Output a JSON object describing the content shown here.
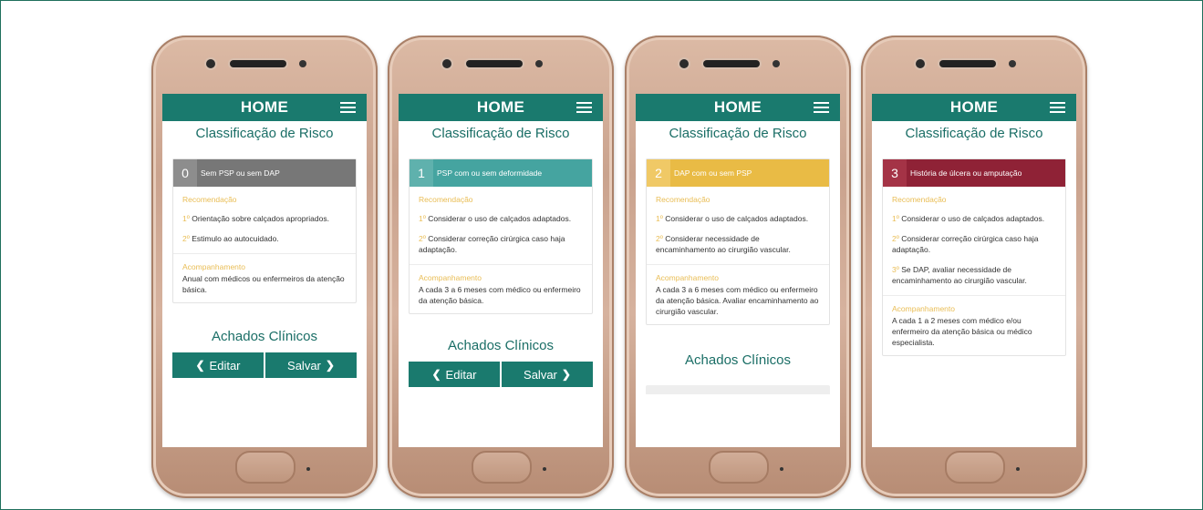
{
  "phones": [
    {
      "home": "HOME",
      "title": "Classificação de Risco",
      "risk": {
        "number": "0",
        "label": "Sem PSP ou sem DAP",
        "num_color": "#8d8d8d",
        "label_color": "#777777"
      },
      "recommendation_title": "Recomendação",
      "recommendations": [
        {
          "ord": "1º",
          "text": " Orientação sobre calçados apropriados."
        },
        {
          "ord": "2º",
          "text": " Estimulo ao autocuidado."
        }
      ],
      "follow_title": "Acompanhamento",
      "follow_text": "Anual com médicos ou enfermeiros da atenção básica.",
      "findings": "Achados Clínicos",
      "edit": "Editar",
      "save": "Salvar"
    },
    {
      "home": "HOME",
      "title": "Classificação de Risco",
      "risk": {
        "number": "1",
        "label": "PSP com ou sem deformidade",
        "num_color": "#5fb1ad",
        "label_color": "#45a4a0"
      },
      "recommendation_title": "Recomendação",
      "recommendations": [
        {
          "ord": "1º",
          "text": " Considerar o uso de calçados adaptados."
        },
        {
          "ord": "2º",
          "text": " Considerar correção cirúrgica caso haja adaptação."
        }
      ],
      "follow_title": "Acompanhamento",
      "follow_text": "A cada 3 a 6 meses com médico ou enfermeiro da atenção básica.",
      "findings": "Achados Clínicos",
      "edit": "Editar",
      "save": "Salvar"
    },
    {
      "home": "HOME",
      "title": "Classificação de Risco",
      "risk": {
        "number": "2",
        "label": "DAP com ou sem PSP",
        "num_color": "#f0c966",
        "label_color": "#e9bb45"
      },
      "recommendation_title": "Recomendação",
      "recommendations": [
        {
          "ord": "1º",
          "text": " Considerar o uso de calçados adaptados."
        },
        {
          "ord": "2º",
          "text": " Considerar necessidade de encaminhamento ao cirurgião vascular."
        }
      ],
      "follow_title": "Acompanhamento",
      "follow_text": "A cada 3 a 6 meses com médico ou enfermeiro da atenção básica. Avaliar encaminhamento ao cirurgião vascular.",
      "findings": "Achados Clínicos"
    },
    {
      "home": "HOME",
      "title": "Classificação de Risco",
      "risk": {
        "number": "3",
        "label": "História de úlcera ou amputação",
        "num_color": "#a43346",
        "label_color": "#8f2236"
      },
      "recommendation_title": "Recomendação",
      "recommendations": [
        {
          "ord": "1º",
          "text": " Considerar o uso de calçados adaptados."
        },
        {
          "ord": "2º",
          "text": " Considerar correção cirúrgica caso haja adaptação."
        },
        {
          "ord": "3º",
          "text": " Se DAP, avaliar necessidade de encaminhamento ao cirurgião vascular."
        }
      ],
      "follow_title": "Acompanhamento",
      "follow_text": "A cada 1 a 2 meses com médico e/ou enfermeiro da atenção básica ou médico especialista."
    }
  ]
}
